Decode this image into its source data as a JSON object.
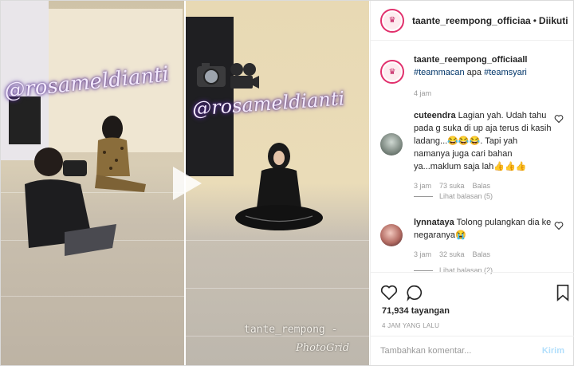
{
  "header": {
    "username": "taante_reempong_officiaa",
    "separator": "•",
    "follow_state": "Diikuti"
  },
  "media": {
    "watermark_left": "@rosameldianti",
    "watermark_right": "@rosameldianti",
    "credit_line1": "tante_rempong -",
    "credit_line2": "PhotoGrid"
  },
  "caption": {
    "username": "taante_reempong_officiaall",
    "tag1": "#teammacan",
    "word": "apa",
    "tag2": "#teamsyari",
    "time": "4 jam"
  },
  "comments": [
    {
      "username": "cuteendra",
      "text": "Lagian yah. Udah tahu pada g suka di up aja terus di kasih ladang...😂😂😂. Tapi yah namanya juga cari bahan ya...maklum saja lah👍👍👍",
      "time": "3 jam",
      "likes": "73 suka",
      "reply": "Balas",
      "view_replies": "Lihat balasan (5)"
    },
    {
      "username": "lynnataya",
      "text": "Tolong pulangkan dia ke negaranya😭",
      "time": "3 jam",
      "likes": "32 suka",
      "reply": "Balas",
      "view_replies": "Lihat balasan (2)"
    }
  ],
  "stats": {
    "views": "71,934 tayangan",
    "posted": "4 JAM YANG LALU"
  },
  "comment_box": {
    "placeholder": "Tambahkan komentar...",
    "post_label": "Kirim"
  },
  "colors": {
    "link": "#003569",
    "muted": "#999999",
    "story_ring": "#e1306c",
    "post_disabled": "#b2dffc"
  }
}
